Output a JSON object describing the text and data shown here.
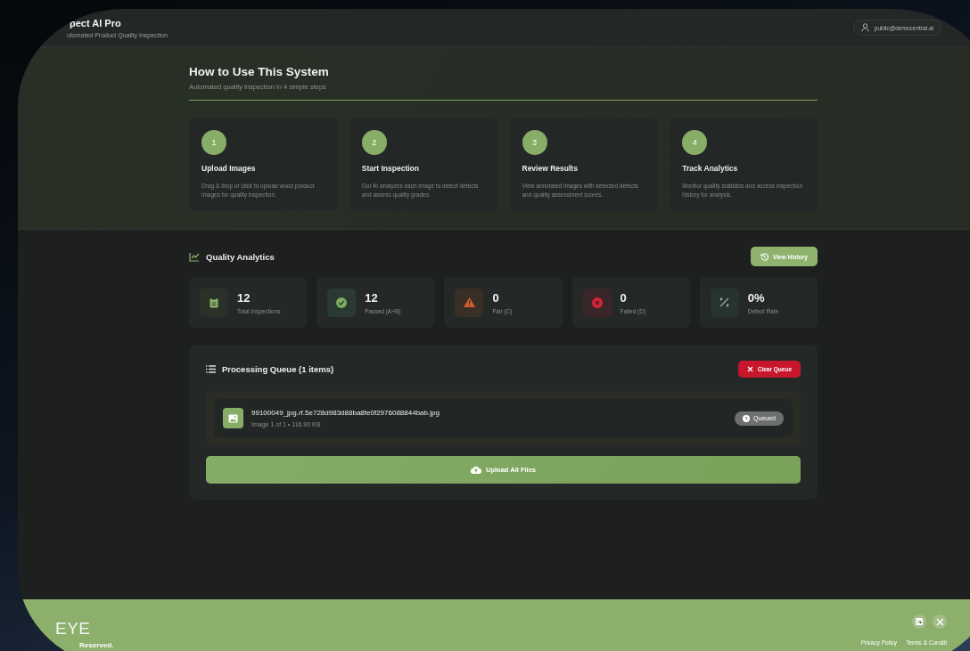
{
  "header": {
    "brand": "pect AI Pro",
    "tagline": "utomated Product Quality Inspection",
    "user": "public@democentral.ai"
  },
  "guide": {
    "title": "How to Use This System",
    "subtitle": "Automated quality inspection in 4 simple steps",
    "steps": [
      {
        "number": "1",
        "title": "Upload Images",
        "text": "Drag & drop or click to upload wood product images for quality inspection."
      },
      {
        "number": "2",
        "title": "Start Inspection",
        "text": "Our AI analyzes each image to detect defects and assess quality grades."
      },
      {
        "number": "3",
        "title": "Review Results",
        "text": "View annotated images with detected defects and quality assessment scores."
      },
      {
        "number": "4",
        "title": "Track Analytics",
        "text": "Monitor quality statistics and access inspection history for analysis."
      }
    ]
  },
  "analytics": {
    "title": "Quality Analytics",
    "history_button": "View History",
    "stats": [
      {
        "kind": "total",
        "value": "12",
        "label": "Total Inspections"
      },
      {
        "kind": "passed",
        "value": "12",
        "label": "Passed (A+B)"
      },
      {
        "kind": "fair",
        "value": "0",
        "label": "Fair (C)"
      },
      {
        "kind": "failed",
        "value": "0",
        "label": "Failed (D)"
      },
      {
        "kind": "rate",
        "value": "0%",
        "label": "Defect Rate"
      }
    ]
  },
  "queue": {
    "title": "Processing Queue (1 items)",
    "clear_button": "Clear Queue",
    "items": [
      {
        "name": "99100049_jpg.rf.5e728d983d88ba8fe0f2976088844bab.jpg",
        "meta": "Image 1 of 1 • 116.90 KB",
        "status": "Queued"
      }
    ],
    "upload_button": "Upload All Files"
  },
  "footer": {
    "logo": "EYE",
    "copyright": "Reserved.",
    "links": [
      "Privacy Policy",
      "Terms & Conditi"
    ]
  }
}
